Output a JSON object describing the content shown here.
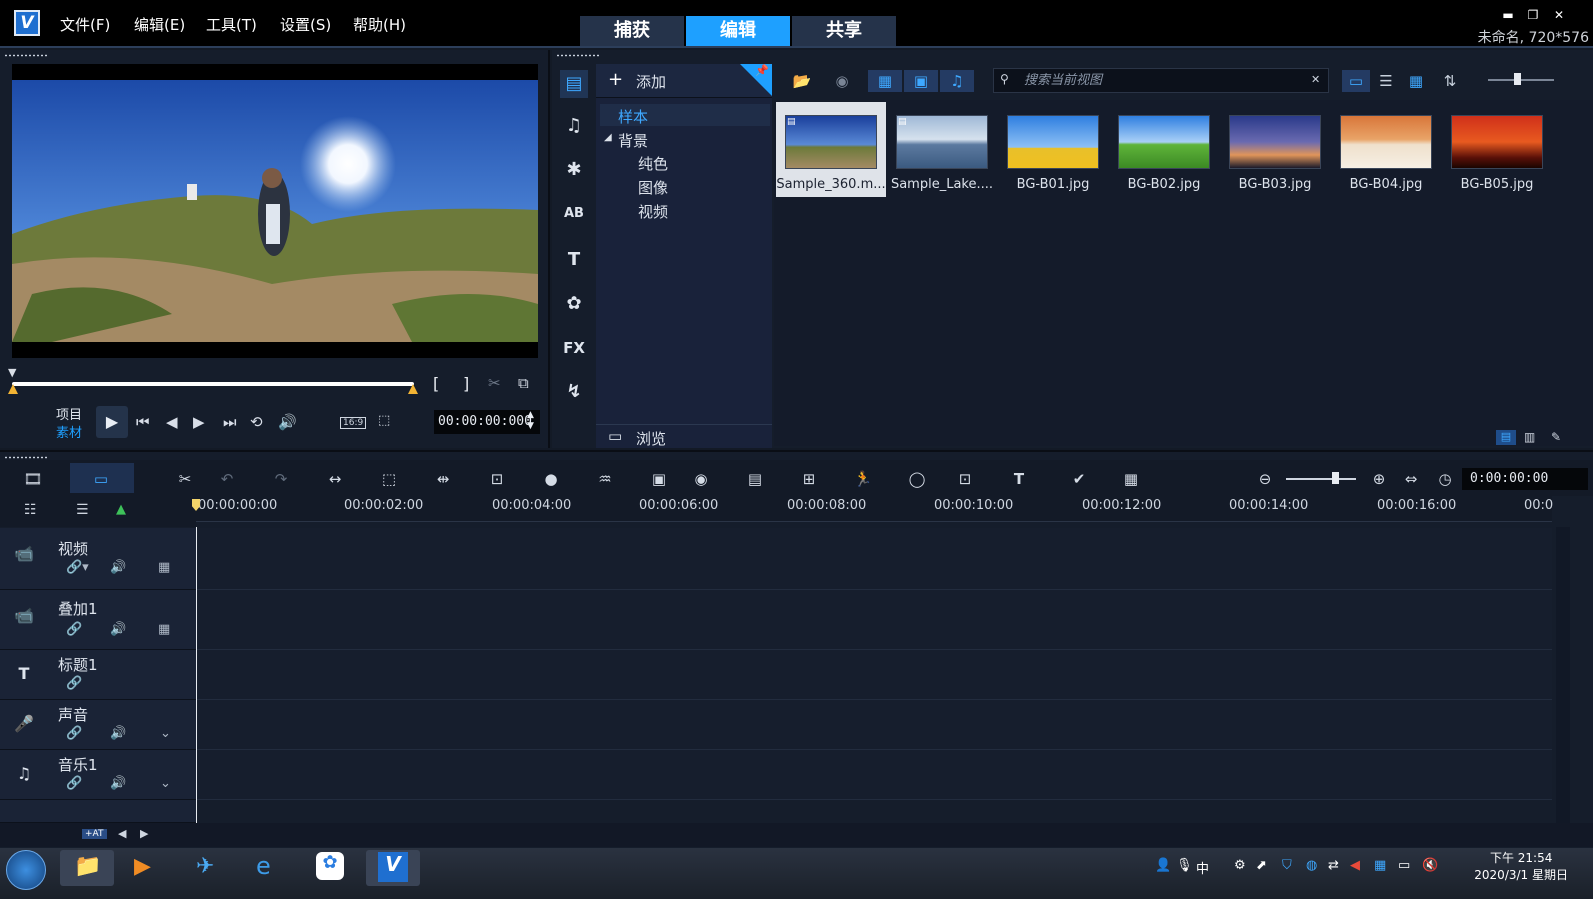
{
  "menu": [
    "文件(F)",
    "编辑(E)",
    "工具(T)",
    "设置(S)",
    "帮助(H)"
  ],
  "tabs": [
    {
      "label": "捕获",
      "active": false
    },
    {
      "label": "编辑",
      "active": true
    },
    {
      "label": "共享",
      "active": false
    }
  ],
  "project_info": "未命名, 720*576",
  "player": {
    "mode_project": "项目",
    "mode_clip": "素材",
    "timecode": "00:00:00:000",
    "aspect": "16:9",
    "brackets": [
      "[",
      "]"
    ]
  },
  "library": {
    "add_label": "添加",
    "tree": {
      "root": "样本",
      "folder": "背景",
      "children": [
        "纯色",
        "图像",
        "视频"
      ]
    },
    "browse_label": "浏览",
    "search_placeholder": "搜索当前视图",
    "thumbnails": [
      {
        "label": "Sample_360.m...",
        "selected": true
      },
      {
        "label": "Sample_Lake....",
        "selected": false
      },
      {
        "label": "BG-B01.jpg",
        "selected": false
      },
      {
        "label": "BG-B02.jpg",
        "selected": false
      },
      {
        "label": "BG-B03.jpg",
        "selected": false
      },
      {
        "label": "BG-B04.jpg",
        "selected": false
      },
      {
        "label": "BG-B05.jpg",
        "selected": false
      }
    ],
    "side_icons": [
      "media-icon",
      "audio-icon",
      "instant-project-icon",
      "transition-icon",
      "title-icon",
      "graphics-icon",
      "fx-icon",
      "path-icon"
    ],
    "fx_label": "FX"
  },
  "timeline": {
    "timecode": "0:00:00:00",
    "ruler": [
      "00:00:00:00",
      "00:00:02:00",
      "00:00:04:00",
      "00:00:06:00",
      "00:00:08:00",
      "00:00:10:00",
      "00:00:12:00",
      "00:00:14:00",
      "00:00:16:00",
      "00:0"
    ],
    "tracks": [
      {
        "name": "视频"
      },
      {
        "name": "叠加1"
      },
      {
        "name": "标题1"
      },
      {
        "name": "声音"
      },
      {
        "name": "音乐1"
      }
    ],
    "add_track_label": "+AT"
  },
  "taskbar": {
    "time": "下午 21:54",
    "date": "2020/3/1 星期日",
    "ime": "中"
  },
  "colors": {
    "accent": "#1ea0ff",
    "background": "#151d2b"
  }
}
